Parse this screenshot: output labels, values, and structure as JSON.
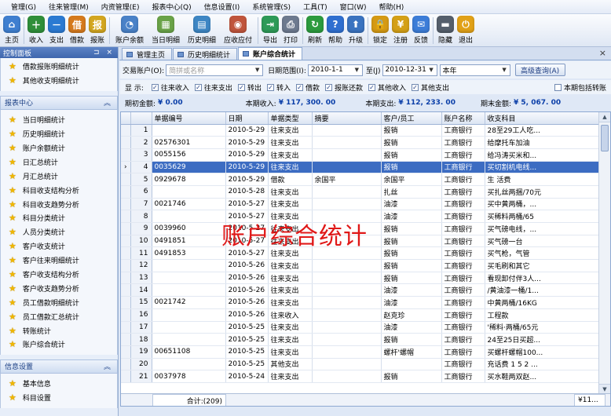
{
  "menu": [
    "管理(G)",
    "往来管理(M)",
    "内资管理(E)",
    "报表中心(Q)",
    "信息设置(I)",
    "系统管理(S)",
    "工具(T)",
    "窗口(W)",
    "帮助(H)"
  ],
  "toolbar": [
    {
      "label": "主页",
      "icon": "home-icon",
      "color": "#3f7fd0",
      "glyph": "⌂"
    },
    {
      "label": "收入",
      "icon": "income-icon",
      "color": "#2f8f3a",
      "glyph": "＋"
    },
    {
      "label": "支出",
      "icon": "expense-icon",
      "color": "#2b7ad2",
      "glyph": "－"
    },
    {
      "label": "借款",
      "icon": "loan-icon",
      "color": "#d57a1d",
      "glyph": "借"
    },
    {
      "label": "报账",
      "icon": "reimburse-icon",
      "color": "#d3a620",
      "glyph": "报"
    },
    {
      "label": "账户余额",
      "icon": "balance-pie-icon",
      "color": "#4a82c8",
      "glyph": "◔"
    },
    {
      "label": "当日明细",
      "icon": "daily-detail-icon",
      "color": "#6aa348",
      "glyph": "▦"
    },
    {
      "label": "历史明细",
      "icon": "history-detail-icon",
      "color": "#3d86c4",
      "glyph": "▤"
    },
    {
      "label": "应收应付",
      "icon": "receivable-icon",
      "color": "#c0553c",
      "glyph": "◉"
    },
    {
      "label": "导出",
      "icon": "export-icon",
      "color": "#2d9a58",
      "glyph": "⇥"
    },
    {
      "label": "打印",
      "icon": "print-icon",
      "color": "#6d7a8f",
      "glyph": "⎙"
    },
    {
      "label": "刷新",
      "icon": "refresh-icon",
      "color": "#2c9b3e",
      "glyph": "↻"
    },
    {
      "label": "帮助",
      "icon": "help-icon",
      "color": "#2f6fd0",
      "glyph": "?"
    },
    {
      "label": "升级",
      "icon": "upgrade-icon",
      "color": "#3a73c0",
      "glyph": "⬆"
    },
    {
      "label": "锁定",
      "icon": "lock-icon",
      "color": "#d59a14",
      "glyph": "🔒"
    },
    {
      "label": "注册",
      "icon": "register-yen-icon",
      "color": "#d4a017",
      "glyph": "¥"
    },
    {
      "label": "反馈",
      "icon": "feedback-icon",
      "color": "#3c7dd8",
      "glyph": "✉"
    },
    {
      "label": "隐藏",
      "icon": "hide-icon",
      "color": "#555f6c",
      "glyph": "▬"
    },
    {
      "label": "退出",
      "icon": "exit-icon",
      "color": "#e1a117",
      "glyph": "⏻"
    }
  ],
  "leftpanel": {
    "title": "控制面板",
    "top_items": [
      "借款报账明细统计",
      "其他收支明细统计"
    ],
    "report_group": "报表中心",
    "report_items": [
      "当日明细统计",
      "历史明细统计",
      "账户余额统计",
      "日汇总统计",
      "月汇总统计",
      "科目收支结构分析",
      "科目收支趋势分析",
      "科目分类统计",
      "人员分类统计",
      "客户收支统计",
      "客户往来明细统计",
      "客户收支结构分析",
      "客户收支趋势分析",
      "员工借款明细统计",
      "员工借款汇总统计",
      "转账统计",
      "账户综合统计"
    ],
    "info_group": "信息设置",
    "info_items": [
      "基本信息",
      "科目设置"
    ]
  },
  "tabs": [
    "管理主页",
    "历史明细统计",
    "账户综合统计"
  ],
  "filter": {
    "account_label": "交易账户(O):",
    "account_placeholder": "简拼或名称",
    "date_label": "日期范围(I):",
    "date_from": "2010-1-1",
    "to_label": "至(J)",
    "date_to": "2010-12-31",
    "period": "本年",
    "advanced_button": "高级查询(A)"
  },
  "display": {
    "label": "显    示:",
    "checks": [
      "往来收入",
      "往来支出",
      "转出",
      "转入",
      "借款",
      "报账还款",
      "其他收入",
      "其他支出"
    ],
    "extra": "本期包括转账"
  },
  "summary": {
    "opening_label": "期初金额:",
    "opening": "¥ 0.00",
    "income_label": "本期收入:",
    "income": "¥ 117, 300. 00",
    "expense_label": "本期支出:",
    "expense": "¥ 112, 233. 00",
    "closing_label": "期末金额:",
    "closing": "¥ 5, 067. 00"
  },
  "grid": {
    "columns": [
      "单据编号",
      "日期",
      "单据类型",
      "摘要",
      "客户/员工",
      "账户名称",
      "收支科目"
    ],
    "rows": [
      [
        "1",
        "",
        "2010-5-29",
        "往来支出",
        "",
        "报销",
        "工商银行",
        "28至29工人吃..."
      ],
      [
        "2",
        "02576301",
        "2010-5-29",
        "往来支出",
        "",
        "报销",
        "工商银行",
        "给摩托车加油"
      ],
      [
        "3",
        "0055156",
        "2010-5-29",
        "往来支出",
        "",
        "报销",
        "工商银行",
        "给冯涛买米和..."
      ],
      [
        "4",
        "0035629",
        "2010-5-29",
        "往来支出",
        "",
        "报销",
        "工商银行",
        "买切割机电线..."
      ],
      [
        "5",
        "0929678",
        "2010-5-29",
        "借款",
        "余国平",
        "余国平",
        "工商银行",
        "生  活费"
      ],
      [
        "6",
        "",
        "2010-5-28",
        "往来支出",
        "",
        "扎丝",
        "工商银行",
        "买扎丝两捆/70元"
      ],
      [
        "7",
        "0021746",
        "2010-5-27",
        "往来支出",
        "",
        "油漆",
        "工商银行",
        "买中黄两桶，..."
      ],
      [
        "8",
        "",
        "2010-5-27",
        "往来支出",
        "",
        "油漆",
        "工商银行",
        "买稀料两桶/65"
      ],
      [
        "9",
        "0039960",
        "2010-5-27",
        "往来支出",
        "",
        "报销",
        "工商银行",
        "买气磅电线，..."
      ],
      [
        "10",
        "0491851",
        "2010-5-27",
        "往来支出",
        "",
        "报销",
        "工商银行",
        "买气磅一台"
      ],
      [
        "11",
        "0491853",
        "2010-5-27",
        "往来支出",
        "",
        "报销",
        "工商银行",
        "买气枪，气管"
      ],
      [
        "12",
        "",
        "2010-5-26",
        "往来支出",
        "",
        "报销",
        "工商银行",
        "买毛刷和其它"
      ],
      [
        "13",
        "",
        "2010-5-26",
        "往来支出",
        "",
        "报销",
        "工商银行",
        "看现卸付伴3人..."
      ],
      [
        "14",
        "",
        "2010-5-26",
        "往来支出",
        "",
        "油漆",
        "工商银行",
        "/黄油漆一桶/1..."
      ],
      [
        "15",
        "0021742",
        "2010-5-26",
        "往来支出",
        "",
        "油漆",
        "工商银行",
        "中黄两桶/16KG"
      ],
      [
        "16",
        "",
        "2010-5-26",
        "往来收入",
        "",
        "赵克珍",
        "工商银行",
        "工程款"
      ],
      [
        "17",
        "",
        "2010-5-25",
        "往来支出",
        "",
        "油漆",
        "工商银行",
        "'稀料·两桶/65元"
      ],
      [
        "18",
        "",
        "2010-5-25",
        "往来支出",
        "",
        "报销",
        "工商银行",
        "24至25日买超..."
      ],
      [
        "19",
        "00651108",
        "2010-5-25",
        "往来支出",
        "",
        "螺杆'螺帽",
        "工商银行",
        "买螺杆螺帽100..."
      ],
      [
        "20",
        "",
        "2010-5-25",
        "其他支出",
        "",
        "",
        "工商银行",
        "充话费 1 5 2 ..."
      ],
      [
        "21",
        "0037978",
        "2010-5-24",
        "往来支出",
        "",
        "报销",
        "工商银行",
        "买水鞋两双赵..."
      ]
    ],
    "selected_row": "4",
    "footer_count": "合计:(209)",
    "footer_total": "¥11..."
  },
  "watermark": "账户综合统计"
}
